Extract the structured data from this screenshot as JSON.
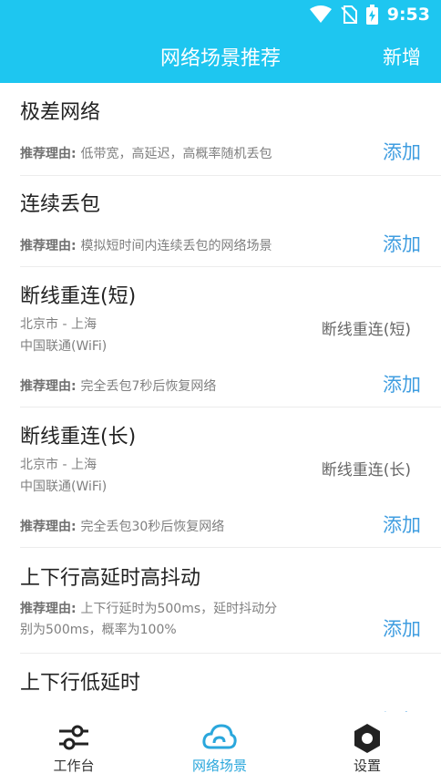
{
  "status": {
    "time": "9:53"
  },
  "header": {
    "title": "网络场景推荐",
    "add_label": "新增"
  },
  "reason_prefix": "推荐理由: ",
  "add_label": "添加",
  "scenes": [
    {
      "title": "极差网络",
      "reason": "低带宽，高延迟，高概率随机丢包"
    },
    {
      "title": "连续丢包",
      "reason": "模拟短时间内连续丢包的网络场景"
    },
    {
      "title": "断线重连(短)",
      "location": "北京市 - 上海",
      "carrier": "中国联通(WiFi)",
      "tag": "断线重连(短)",
      "reason": "完全丢包7秒后恢复网络"
    },
    {
      "title": "断线重连(长)",
      "location": "北京市 - 上海",
      "carrier": "中国联通(WiFi)",
      "tag": "断线重连(长)",
      "reason": "完全丢包30秒后恢复网络"
    },
    {
      "title": "上下行高延时高抖动",
      "reason_line1": "上下行延时为500ms，延时抖动分",
      "reason_line2": "别为500ms，概率为100%"
    },
    {
      "title": "上下行低延时"
    }
  ],
  "nav": [
    {
      "label": "工作台",
      "icon": "sliders-icon"
    },
    {
      "label": "网络场景",
      "icon": "cloud-icon"
    },
    {
      "label": "设置",
      "icon": "settings-icon"
    }
  ],
  "colors": {
    "header": "#1ec6f0",
    "accent": "#3f9de0",
    "nav_active": "#2aa7dc"
  }
}
